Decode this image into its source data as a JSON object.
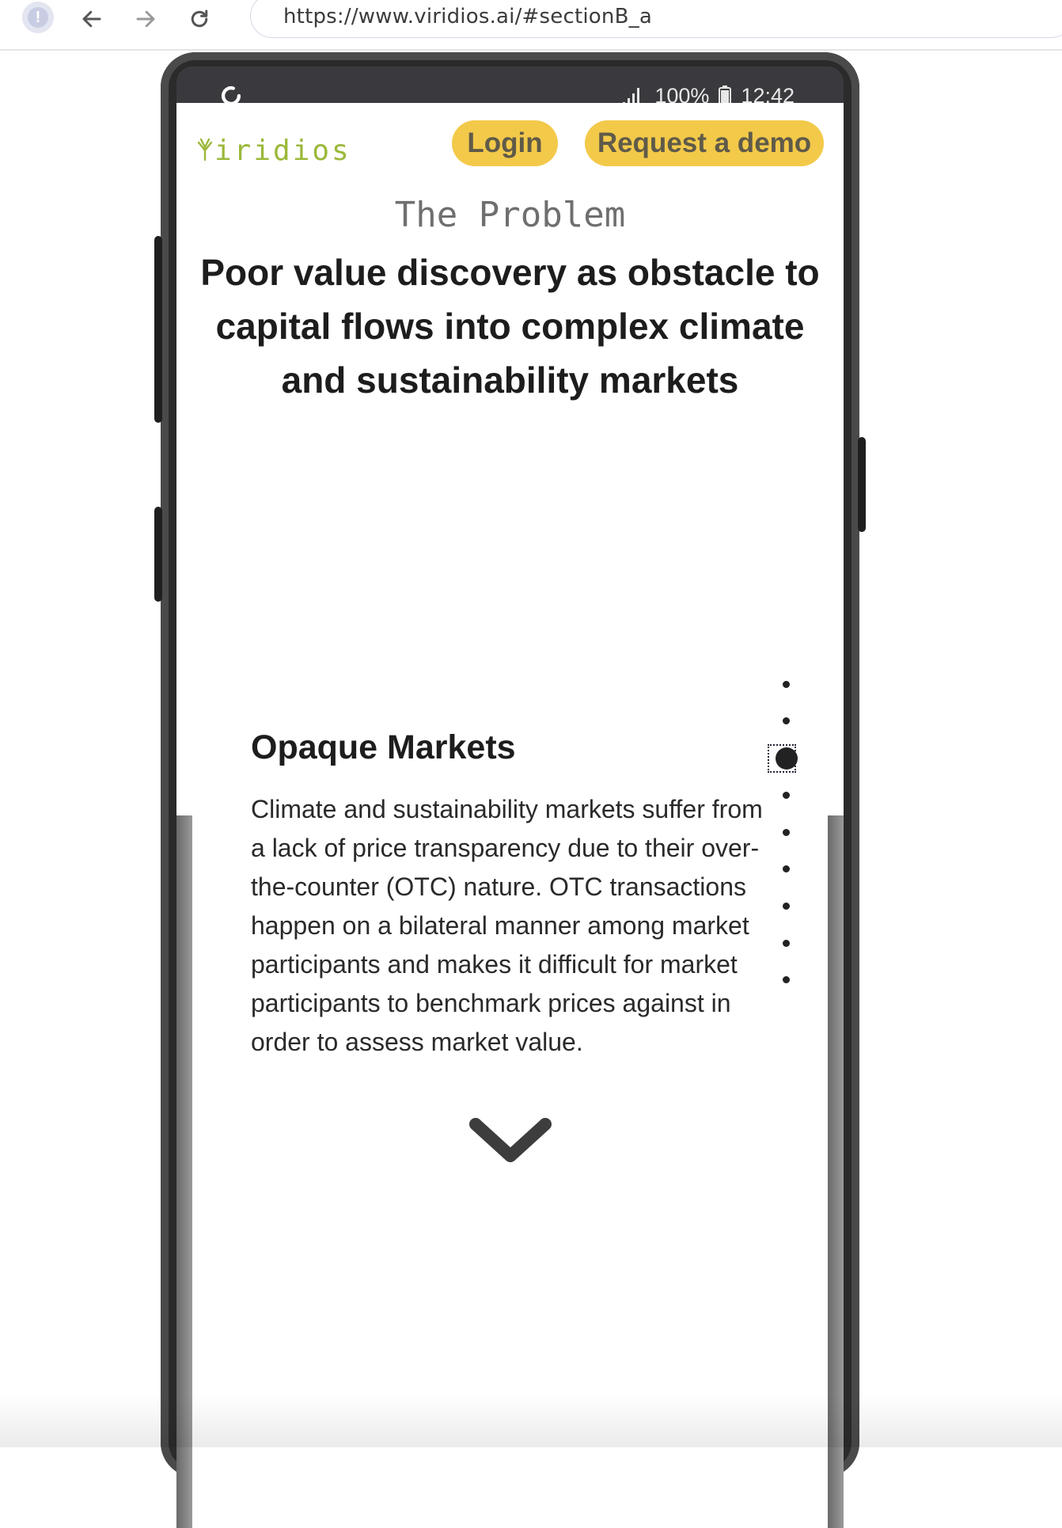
{
  "browser": {
    "url": "https://www.viridios.ai/#sectionB_a",
    "info_icon_glyph": "!"
  },
  "phone": {
    "status": {
      "battery": "100%",
      "time": "12:42"
    }
  },
  "site": {
    "logo_text": "iridios",
    "login_label": "Login",
    "demo_label": "Request a demo",
    "eyebrow": "The Problem",
    "headline": "Poor value discovery as obstacle to capital flows into complex climate and sustainability markets",
    "section_title": "Opaque Markets",
    "section_body": "Climate and sustainability markets suffer from a lack of price transparency due to their over-the-counter (OTC) nature. OTC transactions happen on a bilateral manner among market participants and makes it difficult for market participants to benchmark prices against in order to assess market value.",
    "pagination": {
      "total": 9,
      "active_index": 2
    },
    "accent_color": "#f3c94a",
    "logo_color": "#9bb83a"
  }
}
